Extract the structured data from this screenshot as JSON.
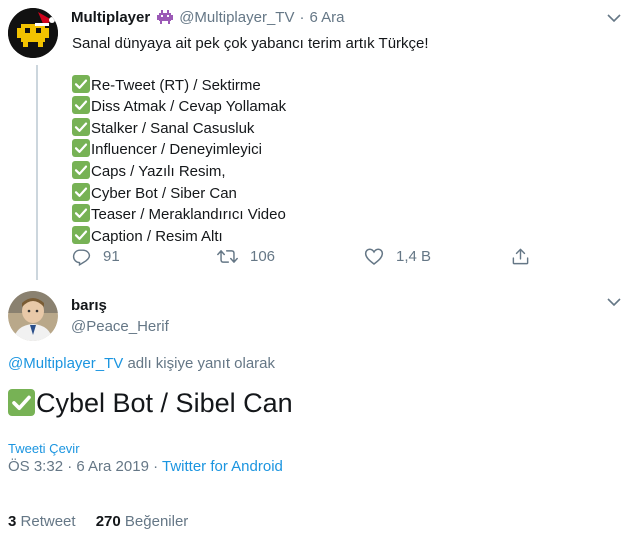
{
  "tweet1": {
    "display_name": "Multiplayer",
    "handle": "@Multiplayer_TV",
    "separator": "·",
    "date": "6 Ara",
    "intro": "Sanal dünyaya ait pek çok yabancı terim artık Türkçe!",
    "items": [
      "Re-Tweet (RT) / Sektirme",
      "Diss Atmak / Cevap Yollamak",
      "Stalker / Sanal Casusluk",
      "Influencer / Deneyimleyici",
      "Caps / Yazılı Resim,",
      "Cyber Bot / Siber Can",
      "Teaser / Meraklandırıcı Video",
      "Caption / Resim Altı"
    ],
    "replies_count": "91",
    "retweets_count": "106",
    "likes_count": "1,4 B"
  },
  "tweet2": {
    "display_name": "barış",
    "handle": "@Peace_Herif",
    "reply_to_handle": "@Multiplayer_TV",
    "reply_to_suffix": "adlı kişiye yanıt olarak",
    "text": "Cybel Bot / Sibel Can",
    "translate_label": "Tweeti Çevir",
    "timestamp": "ÖS 3:32 · 6 Ara 2019 · ",
    "source": "Twitter for Android",
    "retweet_count": "3",
    "retweet_label": "Retweet",
    "like_count": "270",
    "like_label": "Beğeniler"
  },
  "icons": [
    "game-controller-badge-icon",
    "reply-icon",
    "retweet-icon",
    "like-icon",
    "share-icon",
    "chevron-down-icon",
    "check-mark-emoji-icon"
  ],
  "colors": {
    "link": "#1b95e0",
    "muted": "#657786",
    "check": "#77b255",
    "thread_line": "#ccd6dd"
  }
}
